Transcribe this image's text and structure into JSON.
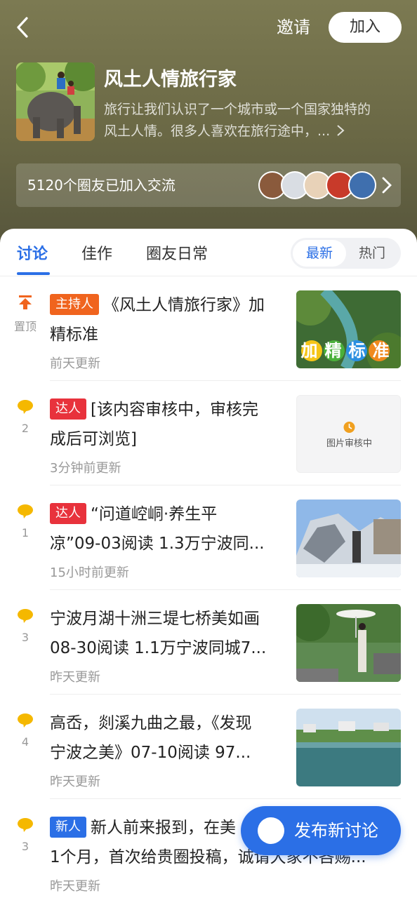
{
  "header": {
    "invite_label": "邀请",
    "join_label": "加入",
    "title": "风土人情旅行家",
    "description_line1": "旅行让我们认识了一个城市或一个国家独特的",
    "description_line2": "风土人情。很多人喜欢在旅行途中，...",
    "members_text": "5120个圈友已加入交流"
  },
  "tabs": [
    "讨论",
    "佳作",
    "圈友日常"
  ],
  "sort": {
    "latest": "最新",
    "hot": "热门"
  },
  "pinned_label": "置顶",
  "posts": [
    {
      "tag": "主持人",
      "tag_color": "#f0641e",
      "line1": "《风土人情旅行家》加",
      "line2": "精标准",
      "time": "前天更新",
      "thumb_text": "加精标准"
    },
    {
      "tag": "达人",
      "tag_color": "#e8323c",
      "count": "2",
      "line1": "[该内容审核中，审核完",
      "line2": "成后可浏览]",
      "time": "3分钟前更新",
      "thumb_text": "图片审核中"
    },
    {
      "tag": "达人",
      "tag_color": "#e8323c",
      "count": "1",
      "line1": "“问道崆峒·养生平",
      "line2": "凉”09-03阅读 1.3万宁波同...",
      "time": "15小时前更新"
    },
    {
      "tag": "",
      "count": "3",
      "line1": "宁波月湖十洲三堤七桥美如画",
      "line2": "08-30阅读 1.1万宁波同城7...",
      "time": "昨天更新"
    },
    {
      "tag": "",
      "count": "4",
      "line1": "高岙，剡溪九曲之最，《发现",
      "line2": "宁波之美》￼07-10阅读 97...",
      "time": "昨天更新"
    },
    {
      "tag": "新人",
      "tag_color": "#2b6fe6",
      "count": "3",
      "line1": "新人前来报到，在美",
      "line2": "1个月，首次给贵圈投稿，诚请大家不吝赐...",
      "time": "昨天更新"
    }
  ],
  "fab": {
    "label": "发布新讨论"
  },
  "colors": {
    "accent": "#2b6fe6",
    "header_bg": "#6e6c48",
    "comment_icon": "#f5b800",
    "pin_icon": "#f0641e"
  }
}
